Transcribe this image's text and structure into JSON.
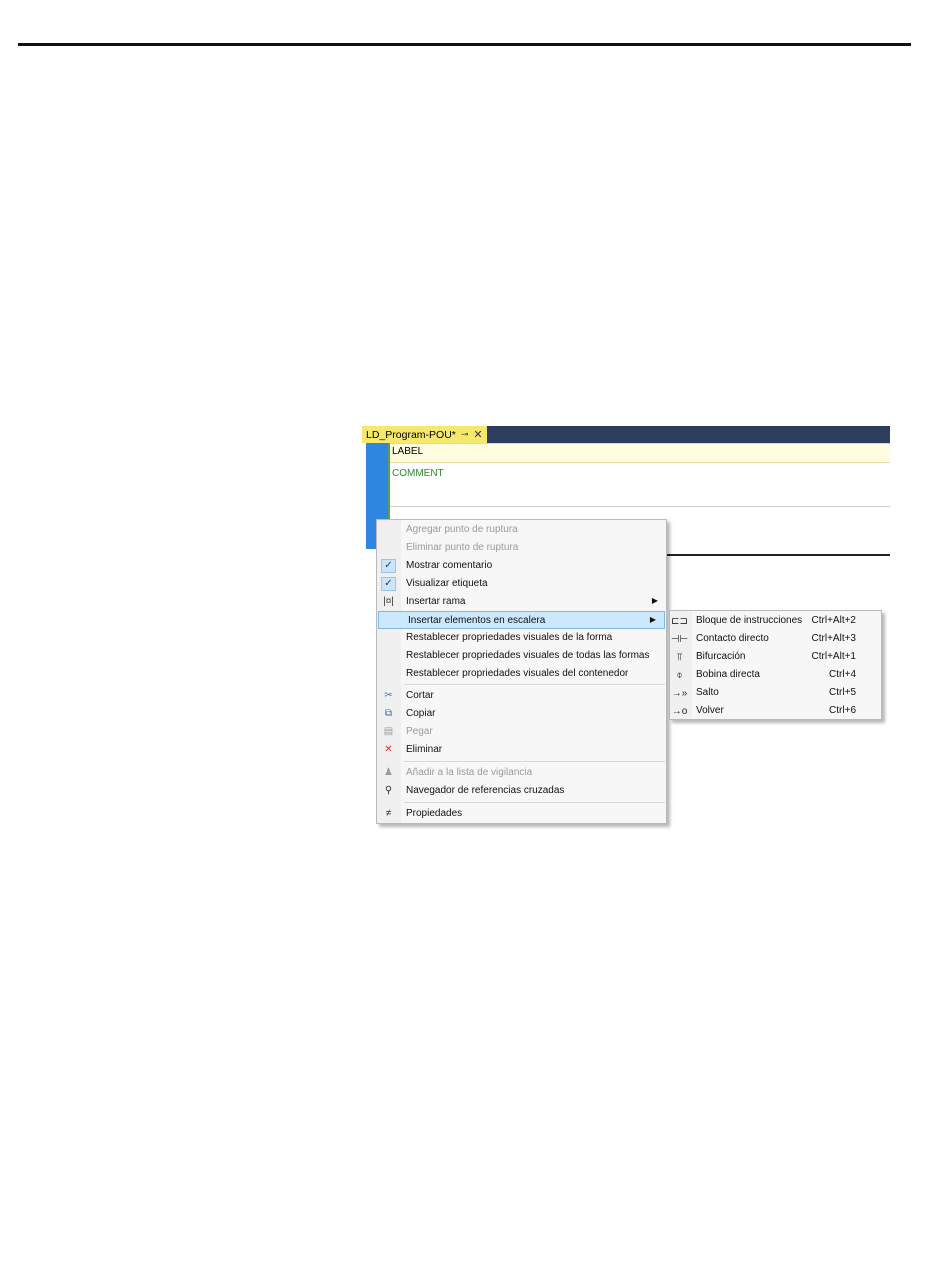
{
  "tab": {
    "title": "LD_Program-POU*",
    "pin": "⊸",
    "close": "✕"
  },
  "editor": {
    "label": "LABEL",
    "comment": "COMMENT"
  },
  "menu": {
    "items": [
      {
        "label": "Agregar punto de ruptura",
        "icon": "",
        "icon_name": "none",
        "state": "disabled"
      },
      {
        "label": "Eliminar punto de ruptura",
        "icon": "",
        "icon_name": "none",
        "state": "disabled"
      },
      {
        "label": "Mostrar comentario",
        "icon": "✓",
        "icon_name": "check-icon",
        "state": "checked"
      },
      {
        "label": "Visualizar etiqueta",
        "icon": "✓",
        "icon_name": "check-icon",
        "state": "checked"
      },
      {
        "label": "Insertar rama",
        "icon": "|¤|",
        "icon_name": "branch-icon",
        "state": "normal",
        "submenu": true
      },
      {
        "label": "Insertar elementos en escalera",
        "icon": "",
        "icon_name": "none",
        "state": "highlight",
        "submenu": true
      },
      {
        "label": "Restablecer propriedades visuales de la forma",
        "icon": "",
        "icon_name": "none",
        "state": "normal"
      },
      {
        "label": "Restablecer propriedades visuales de todas las formas",
        "icon": "",
        "icon_name": "none",
        "state": "normal"
      },
      {
        "label": "Restablecer propriedades visuales del contenedor",
        "icon": "",
        "icon_name": "none",
        "state": "normal"
      },
      {
        "label": "Cortar",
        "icon": "✂",
        "icon_name": "scissors-icon",
        "state": "normal"
      },
      {
        "label": "Copiar",
        "icon": "⧉",
        "icon_name": "copy-icon",
        "state": "normal"
      },
      {
        "label": "Pegar",
        "icon": "▤",
        "icon_name": "paste-icon",
        "state": "disabled"
      },
      {
        "label": "Eliminar",
        "icon": "✕",
        "icon_name": "delete-icon",
        "state": "normal"
      },
      {
        "label": "Añadir a la lista de vigilancia",
        "icon": "♟",
        "icon_name": "watch-icon",
        "state": "disabled"
      },
      {
        "label": "Navegador de referencias cruzadas",
        "icon": "⚲",
        "icon_name": "magnifier-icon",
        "state": "normal"
      },
      {
        "label": "Propiedades",
        "icon": "≠",
        "icon_name": "properties-icon",
        "state": "normal"
      }
    ],
    "arrow": "▶"
  },
  "submenu": {
    "items": [
      {
        "label": "Bloque de instrucciones",
        "shortcut": "Ctrl+Alt+2",
        "icon": "⊏⊐",
        "icon_name": "instruction-block-icon"
      },
      {
        "label": "Contacto directo",
        "shortcut": "Ctrl+Alt+3",
        "icon": "⊣⊢",
        "icon_name": "direct-contact-icon"
      },
      {
        "label": "Bifurcación",
        "shortcut": "Ctrl+Alt+1",
        "icon": "⫪",
        "icon_name": "branch-icon"
      },
      {
        "label": "Bobina directa",
        "shortcut": "Ctrl+4",
        "icon": "⌽",
        "icon_name": "direct-coil-icon"
      },
      {
        "label": "Salto",
        "shortcut": "Ctrl+5",
        "icon": "→»",
        "icon_name": "jump-icon"
      },
      {
        "label": "Volver",
        "shortcut": "Ctrl+6",
        "icon": "→o",
        "icon_name": "return-icon"
      }
    ]
  },
  "colors": {
    "tab_active": "#f5e86c",
    "tabbar": "#2c3e5c",
    "gutter": "#2f86e0",
    "comment_text": "#2e8b2e",
    "highlight": "#cce8fb"
  }
}
